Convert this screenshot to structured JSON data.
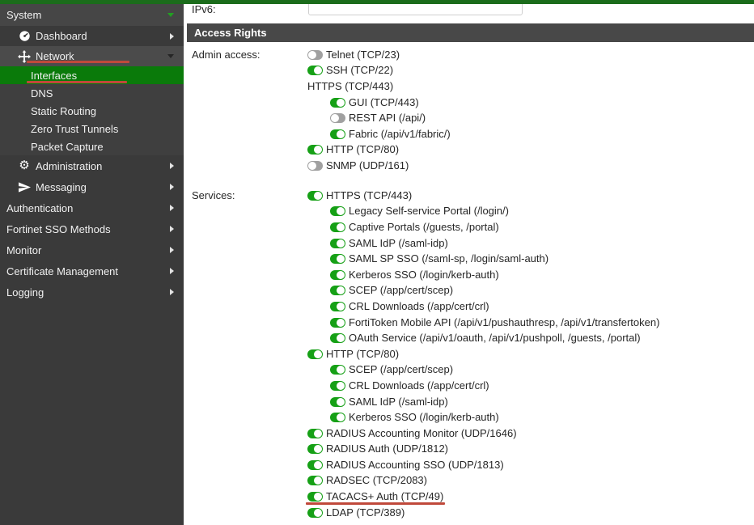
{
  "colors": {
    "topbar_green": "#1b6c1b",
    "sidebar_bg": "#3a3a3a",
    "sidebar_header_bg": "#464646",
    "expanded_item_bg": "#4b4b4b",
    "submenu_bg": "#3f3f3f",
    "selected_green": "#0a7a0a",
    "toggle_on_green": "#16a016",
    "toggle_off_gray": "#a0a0a0",
    "section_header_bg": "#484848",
    "annotation_red": "#c0493b"
  },
  "sidebar": {
    "system_label": "System",
    "items": [
      {
        "label": "Dashboard",
        "type": "top",
        "icon": "gauge-icon",
        "caret": "right"
      },
      {
        "label": "Network",
        "type": "top",
        "icon": "move-icon",
        "caret": "down",
        "expanded": true,
        "annotated": true,
        "annot_width": 127
      },
      {
        "label": "Interfaces",
        "type": "sub",
        "selected": true,
        "annotated": true,
        "annot_width": 124
      },
      {
        "label": "DNS",
        "type": "sub"
      },
      {
        "label": "Static Routing",
        "type": "sub"
      },
      {
        "label": "Zero Trust Tunnels",
        "type": "sub"
      },
      {
        "label": "Packet Capture",
        "type": "sub"
      },
      {
        "label": "Administration",
        "type": "mid",
        "icon": "gear-icon",
        "caret": "right"
      },
      {
        "label": "Messaging",
        "type": "mid",
        "icon": "paper-plane-icon",
        "caret": "right"
      },
      {
        "label": "Authentication",
        "type": "root",
        "caret": "right"
      },
      {
        "label": "Fortinet SSO Methods",
        "type": "root",
        "caret": "right"
      },
      {
        "label": "Monitor",
        "type": "root",
        "caret": "right"
      },
      {
        "label": "Certificate Management",
        "type": "root",
        "caret": "right"
      },
      {
        "label": "Logging",
        "type": "root",
        "caret": "right"
      }
    ]
  },
  "form": {
    "ipv6_label": "IPv6:",
    "ipv6_value": "",
    "section_header": "Access Rights",
    "admin_access": {
      "label": "Admin access:",
      "rows": [
        {
          "text": "Telnet (TCP/23)",
          "toggle": "off",
          "indent": 0
        },
        {
          "text": "SSH (TCP/22)",
          "toggle": "on",
          "indent": 0
        },
        {
          "text": "HTTPS (TCP/443)",
          "toggle": null,
          "indent": 0
        },
        {
          "text": "GUI (TCP/443)",
          "toggle": "on",
          "indent": 1
        },
        {
          "text": "REST API (/api/)",
          "toggle": "off",
          "indent": 1
        },
        {
          "text": "Fabric (/api/v1/fabric/)",
          "toggle": "on",
          "indent": 1
        },
        {
          "text": "HTTP (TCP/80)",
          "toggle": "on",
          "indent": 0
        },
        {
          "text": "SNMP (UDP/161)",
          "toggle": "off",
          "indent": 0
        }
      ]
    },
    "services": {
      "label": "Services:",
      "rows": [
        {
          "text": "HTTPS (TCP/443)",
          "toggle": "on",
          "indent": 0
        },
        {
          "text": "Legacy Self-service Portal (/login/)",
          "toggle": "on",
          "indent": 1
        },
        {
          "text": "Captive Portals (/guests, /portal)",
          "toggle": "on",
          "indent": 1
        },
        {
          "text": "SAML IdP (/saml-idp)",
          "toggle": "on",
          "indent": 1
        },
        {
          "text": "SAML SP SSO (/saml-sp, /login/saml-auth)",
          "toggle": "on",
          "indent": 1
        },
        {
          "text": "Kerberos SSO (/login/kerb-auth)",
          "toggle": "on",
          "indent": 1
        },
        {
          "text": "SCEP (/app/cert/scep)",
          "toggle": "on",
          "indent": 1
        },
        {
          "text": "CRL Downloads (/app/cert/crl)",
          "toggle": "on",
          "indent": 1
        },
        {
          "text": "FortiToken Mobile API (/api/v1/pushauthresp, /api/v1/transfertoken)",
          "toggle": "on",
          "indent": 1
        },
        {
          "text": "OAuth Service (/api/v1/oauth, /api/v1/pushpoll, /guests, /portal)",
          "toggle": "on",
          "indent": 1
        },
        {
          "text": "HTTP (TCP/80)",
          "toggle": "on",
          "indent": 0
        },
        {
          "text": "SCEP (/app/cert/scep)",
          "toggle": "on",
          "indent": 1
        },
        {
          "text": "CRL Downloads (/app/cert/crl)",
          "toggle": "on",
          "indent": 1
        },
        {
          "text": "SAML IdP (/saml-idp)",
          "toggle": "on",
          "indent": 1
        },
        {
          "text": "Kerberos SSO (/login/kerb-auth)",
          "toggle": "on",
          "indent": 1
        },
        {
          "text": "RADIUS Accounting Monitor (UDP/1646)",
          "toggle": "on",
          "indent": 0
        },
        {
          "text": "RADIUS Auth (UDP/1812)",
          "toggle": "on",
          "indent": 0
        },
        {
          "text": "RADIUS Accounting SSO (UDP/1813)",
          "toggle": "on",
          "indent": 0
        },
        {
          "text": "RADSEC (TCP/2083)",
          "toggle": "on",
          "indent": 0
        },
        {
          "text": "TACACS+ Auth (TCP/49)",
          "toggle": "on",
          "indent": 0,
          "annotated": true
        },
        {
          "text": "LDAP (TCP/389)",
          "toggle": "on",
          "indent": 0
        }
      ]
    }
  }
}
